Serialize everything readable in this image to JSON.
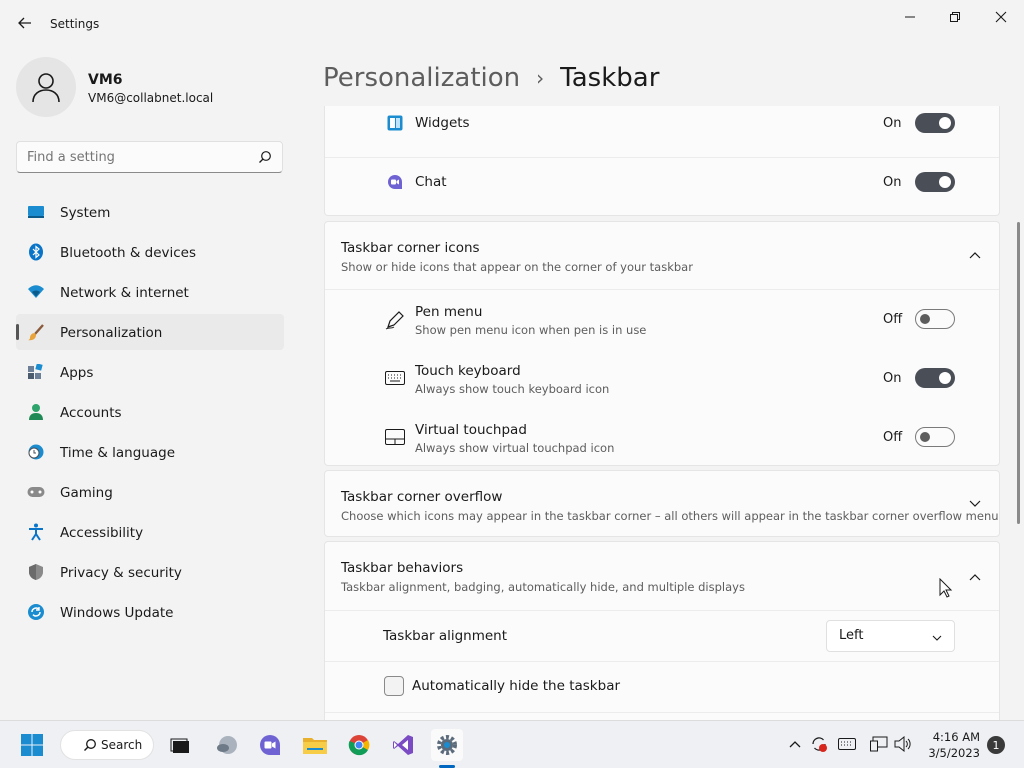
{
  "window": {
    "title": "Settings",
    "controls": [
      "minimize",
      "maximize",
      "close"
    ]
  },
  "profile": {
    "name": "VM6",
    "email": "VM6@collabnet.local"
  },
  "search": {
    "placeholder": "Find a setting"
  },
  "sidebar": {
    "items": [
      {
        "label": "System",
        "icon": "system-icon"
      },
      {
        "label": "Bluetooth & devices",
        "icon": "bluetooth-icon"
      },
      {
        "label": "Network & internet",
        "icon": "wifi-icon"
      },
      {
        "label": "Personalization",
        "icon": "brush-icon",
        "active": true
      },
      {
        "label": "Apps",
        "icon": "apps-icon"
      },
      {
        "label": "Accounts",
        "icon": "accounts-icon"
      },
      {
        "label": "Time & language",
        "icon": "clock-globe-icon"
      },
      {
        "label": "Gaming",
        "icon": "gamepad-icon"
      },
      {
        "label": "Accessibility",
        "icon": "accessibility-icon"
      },
      {
        "label": "Privacy & security",
        "icon": "shield-icon"
      },
      {
        "label": "Windows Update",
        "icon": "update-icon"
      }
    ]
  },
  "breadcrumb": {
    "parent": "Personalization",
    "separator": "›",
    "current": "Taskbar"
  },
  "taskbar_items": {
    "widgets": {
      "label": "Widgets",
      "state": "On",
      "on": true
    },
    "chat": {
      "label": "Chat",
      "state": "On",
      "on": true
    }
  },
  "corner_icons": {
    "title": "Taskbar corner icons",
    "subtitle": "Show or hide icons that appear on the corner of your taskbar",
    "expanded": true,
    "items": [
      {
        "label": "Pen menu",
        "desc": "Show pen menu icon when pen is in use",
        "state": "Off",
        "on": false
      },
      {
        "label": "Touch keyboard",
        "desc": "Always show touch keyboard icon",
        "state": "On",
        "on": true
      },
      {
        "label": "Virtual touchpad",
        "desc": "Always show virtual touchpad icon",
        "state": "Off",
        "on": false
      }
    ]
  },
  "corner_overflow": {
    "title": "Taskbar corner overflow",
    "subtitle": "Choose which icons may appear in the taskbar corner – all others will appear in the taskbar corner overflow menu",
    "expanded": false
  },
  "behaviors": {
    "title": "Taskbar behaviors",
    "subtitle": "Taskbar alignment, badging, automatically hide, and multiple displays",
    "expanded": true,
    "alignment_label": "Taskbar alignment",
    "alignment_value": "Left",
    "autohide_label": "Automatically hide the taskbar",
    "autohide_checked": false
  },
  "taskbar": {
    "search_label": "Search",
    "pinned": [
      "start-icon",
      "search-icon",
      "task-view-icon",
      "widgets-icon",
      "chat-icon",
      "file-explorer-icon",
      "chrome-icon",
      "visual-studio-icon",
      "settings-icon"
    ],
    "active_app": "settings-icon",
    "time": "4:16 AM",
    "date": "3/5/2023",
    "notification_count": "1"
  },
  "colors": {
    "toggle_on": "#4a4f57",
    "accent": "#0067c0",
    "background": "#f3f3f3",
    "card": "#fbfbfb"
  }
}
